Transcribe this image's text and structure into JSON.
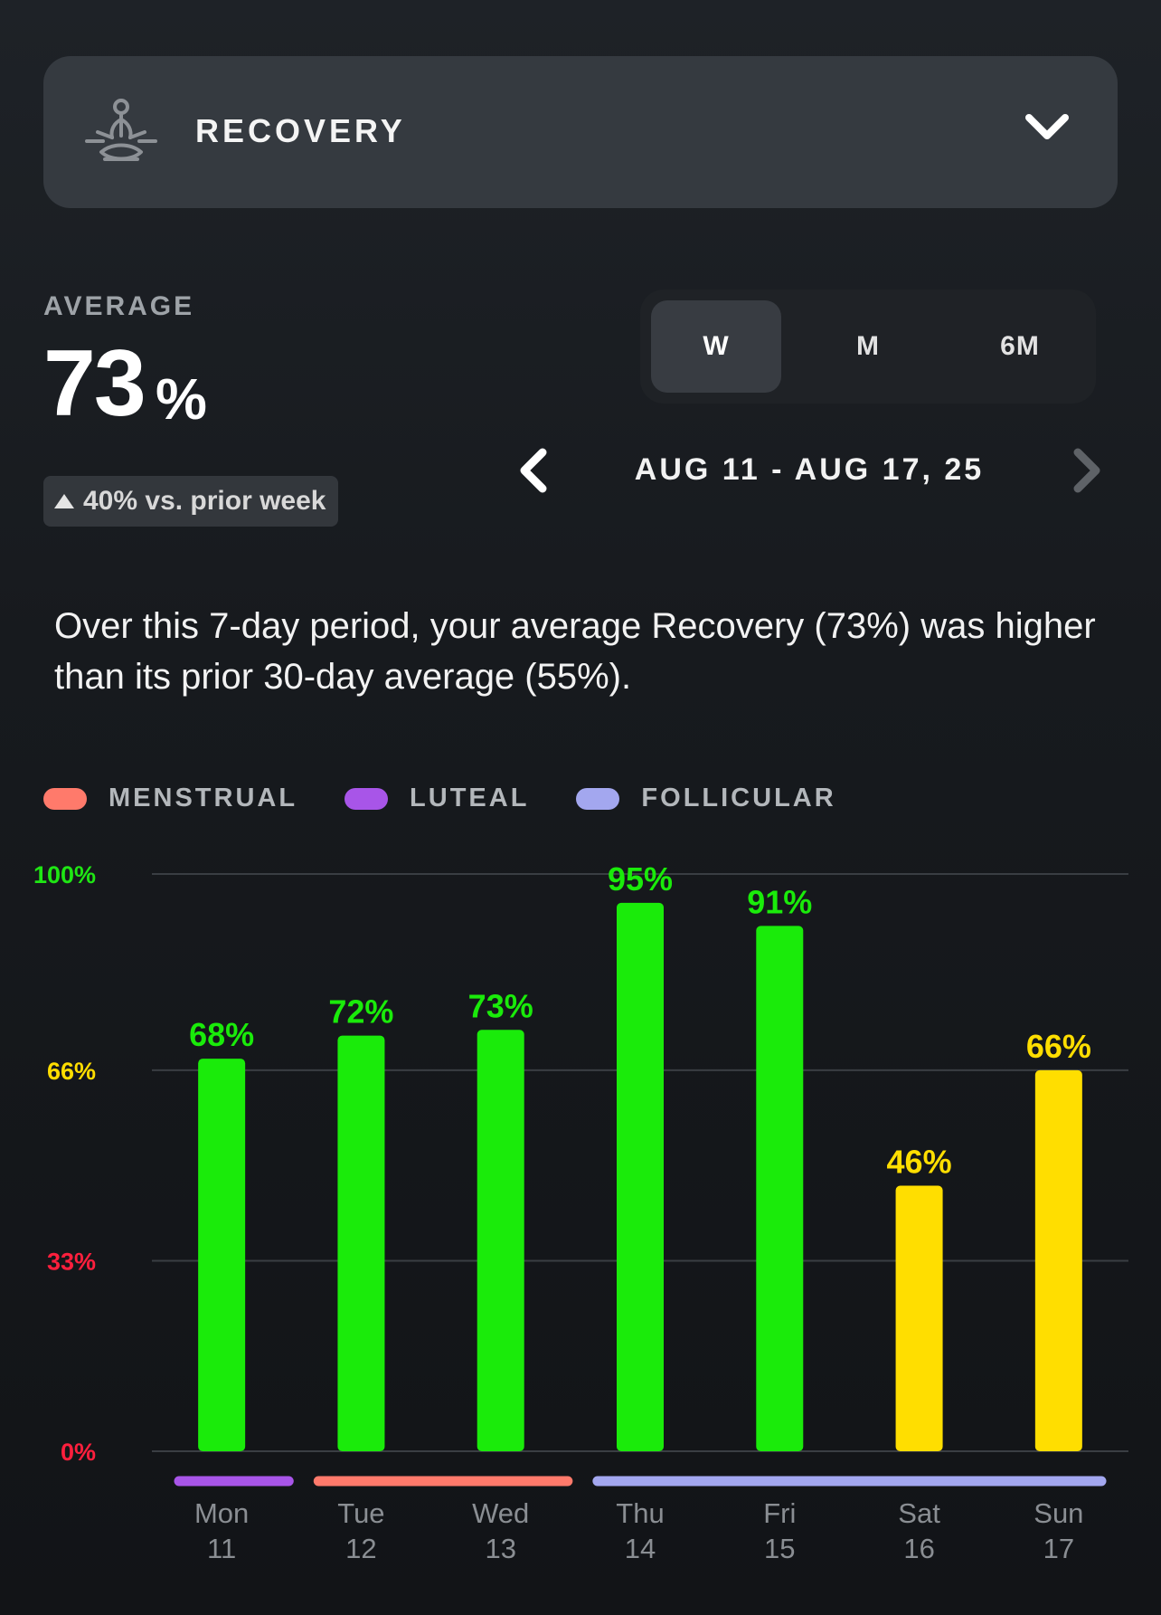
{
  "header": {
    "title": "RECOVERY",
    "icon": "meditation-icon"
  },
  "average": {
    "label": "AVERAGE",
    "value": "73",
    "unit": "%",
    "change_text": "40% vs. prior week",
    "change_direction": "up"
  },
  "range_switch": {
    "options": [
      "W",
      "M",
      "6M"
    ],
    "selected": "W"
  },
  "period": {
    "label": "AUG 11 - AUG 17, 25"
  },
  "summary": "Over this 7-day period, your average Recovery (73%) was higher than its prior 30-day average (55%).",
  "legend": [
    {
      "label": "MENSTRUAL",
      "color": "#ff7a6b"
    },
    {
      "label": "LUTEAL",
      "color": "#a855e8"
    },
    {
      "label": "FOLLICULAR",
      "color": "#a3a7ef"
    }
  ],
  "chart_data": {
    "type": "bar",
    "categories": [
      "Mon 11",
      "Tue 12",
      "Wed 13",
      "Thu 14",
      "Fri 15",
      "Sat 16",
      "Sun 17"
    ],
    "day_names": [
      "Mon",
      "Tue",
      "Wed",
      "Thu",
      "Fri",
      "Sat",
      "Sun"
    ],
    "day_numbers": [
      "11",
      "12",
      "13",
      "14",
      "15",
      "16",
      "17"
    ],
    "values": [
      68,
      72,
      73,
      95,
      91,
      46,
      66
    ],
    "value_labels": [
      "68%",
      "72%",
      "73%",
      "95%",
      "91%",
      "46%",
      "66%"
    ],
    "ylim": [
      0,
      100
    ],
    "yticks": [
      {
        "value": 100,
        "label": "100%",
        "color": "#1fe614"
      },
      {
        "value": 66,
        "label": "66%",
        "color": "#ffdd00"
      },
      {
        "value": 33,
        "label": "33%",
        "color": "#ff1f3d"
      },
      {
        "value": 0,
        "label": "0%",
        "color": "#ff1f3d"
      }
    ],
    "zone_colors": {
      "green": "#1aeb0a",
      "yellow": "#ffde00",
      "red": "#ff1f3d"
    },
    "cycle_phases": [
      {
        "phase": "LUTEAL",
        "start_day": 0,
        "end_day": 0,
        "color": "#a855e8"
      },
      {
        "phase": "MENSTRUAL",
        "start_day": 1,
        "end_day": 2,
        "color": "#ff7a6b"
      },
      {
        "phase": "FOLLICULAR",
        "start_day": 3,
        "end_day": 6,
        "color": "#a3a7ef"
      }
    ],
    "grid": true
  }
}
